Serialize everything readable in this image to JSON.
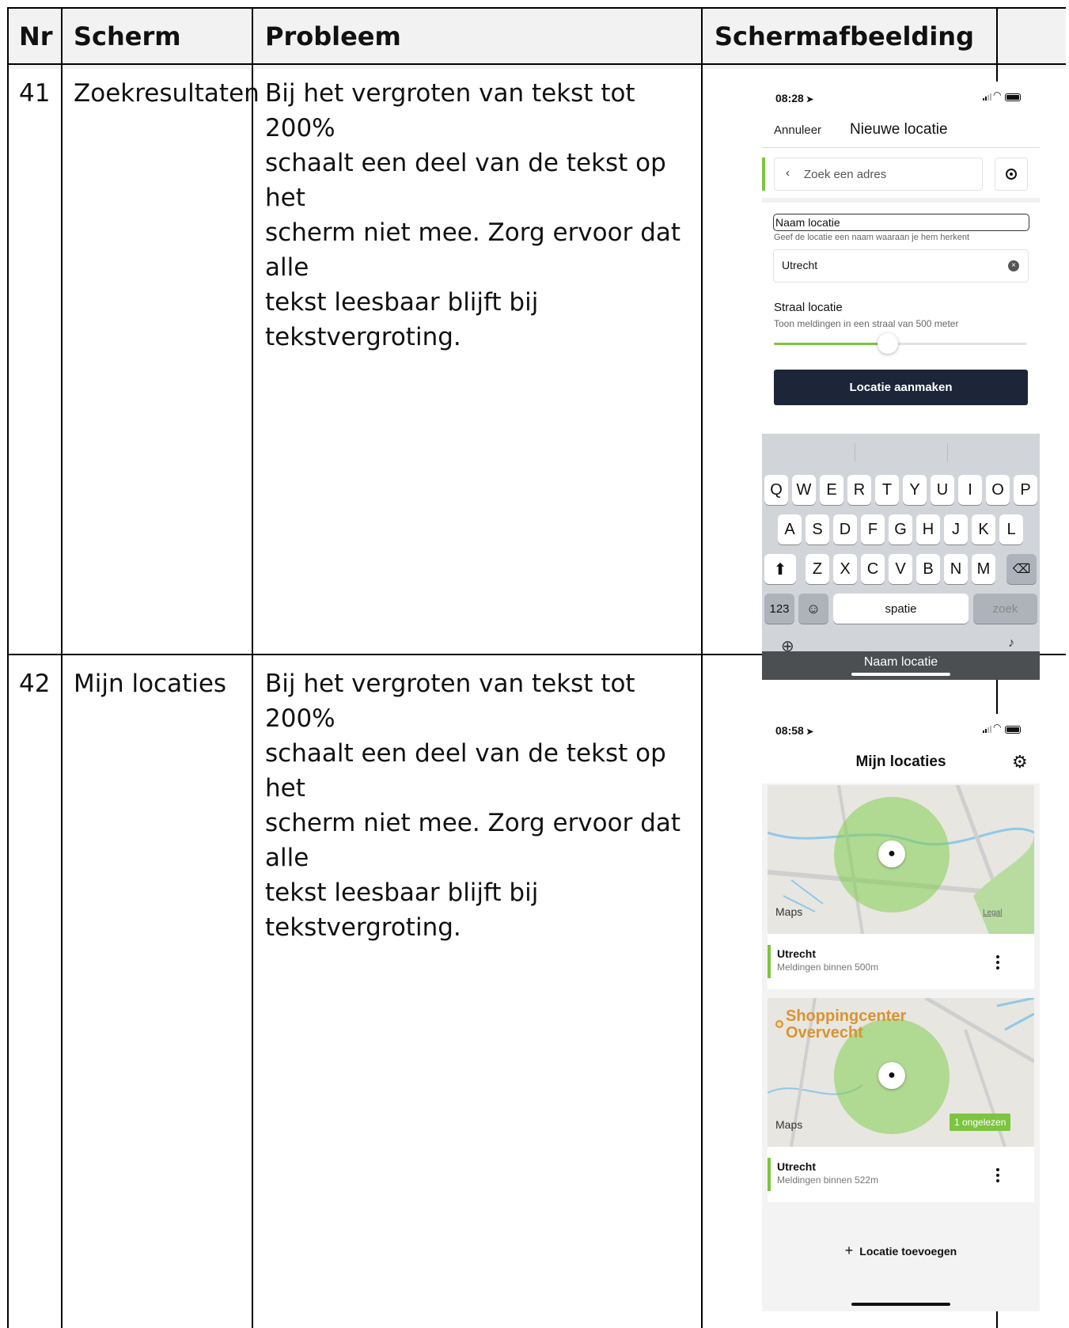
{
  "table": {
    "headers": {
      "nr": "Nr",
      "scherm": "Scherm",
      "probleem": "Probleem",
      "schermafbeelding": "Schermafbeelding"
    },
    "rows": [
      {
        "nr": "41",
        "scherm": "Zoekresultaten",
        "probleem_lines": [
          "Bij het vergroten van tekst tot 200%",
          "schaalt een deel van de tekst op het",
          "scherm niet mee. Zorg ervoor dat alle",
          "tekst leesbaar blijft bij tekstvergroting."
        ]
      },
      {
        "nr": "42",
        "scherm": "Mijn locaties",
        "probleem_lines": [
          "Bij het vergroten van tekst tot 200%",
          "schaalt een deel van de tekst op het",
          "scherm niet mee. Zorg ervoor dat alle",
          "tekst leesbaar blijft bij tekstvergroting."
        ]
      }
    ]
  },
  "screen1": {
    "time": "08:28",
    "cancel": "Annuleer",
    "title": "Nieuwe locatie",
    "search_placeholder": "Zoek een adres",
    "name_label": "Naam locatie",
    "name_hint": "Geef de locatie een naam waaraan je hem herkent",
    "name_value": "Utrecht",
    "radius_label": "Straal locatie",
    "radius_hint": "Toon meldingen in een straal van 500 meter",
    "slider_fraction": 0.45,
    "create_button": "Locatie aanmaken",
    "keyboard": {
      "row1": [
        "Q",
        "W",
        "E",
        "R",
        "T",
        "Y",
        "U",
        "I",
        "O",
        "P"
      ],
      "row2": [
        "A",
        "S",
        "D",
        "F",
        "G",
        "H",
        "J",
        "K",
        "L"
      ],
      "row3": [
        "Z",
        "X",
        "C",
        "V",
        "B",
        "N",
        "M"
      ],
      "numbers": "123",
      "space": "spatie",
      "search": "zoek"
    },
    "toolbar_label": "Naam locatie",
    "colors": {
      "accent": "#7cc540",
      "button": "#1c2638",
      "keyboard": "#d1d4d9"
    }
  },
  "screen2": {
    "time": "08:58",
    "title": "Mijn locaties",
    "maps_label": "Maps",
    "legal_label": "Legal",
    "cards": [
      {
        "name": "Utrecht",
        "subtitle": "Meldingen binnen 500m"
      },
      {
        "name": "Utrecht",
        "subtitle": "Meldingen binnen 522m"
      }
    ],
    "poi_label_1": "Shoppingcenter",
    "poi_label_2": "Overvecht",
    "unread_badge": "1 ongelezen",
    "add_location": "Locatie toevoegen",
    "colors": {
      "circle": "#82cd50",
      "badge": "#7cc540",
      "poi": "#d99430"
    }
  }
}
